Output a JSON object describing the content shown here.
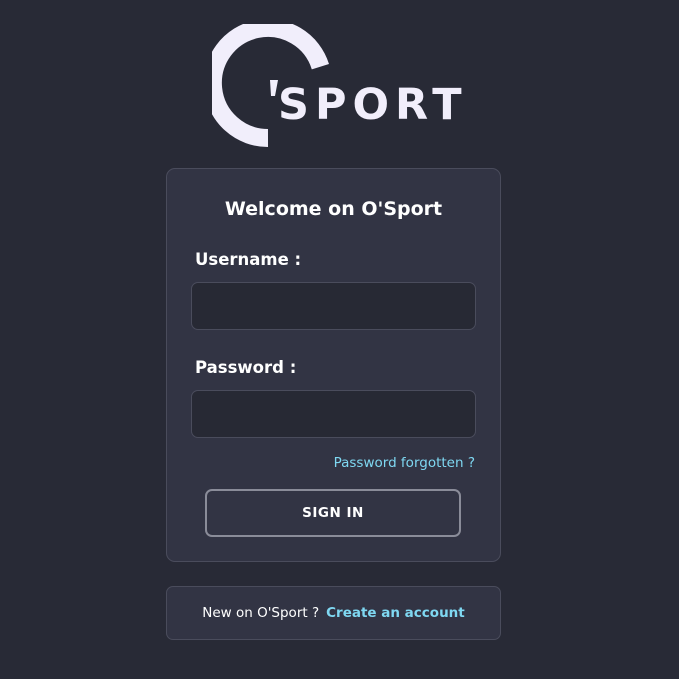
{
  "logo": {
    "wordmark": "SPORT",
    "color": "#f1eefb"
  },
  "login": {
    "title": "Welcome on O'Sport",
    "username_label": "Username :",
    "username_value": "",
    "password_label": "Password :",
    "password_value": "",
    "forgot_link": "Password forgotten ?",
    "signin_button": "SIGN IN"
  },
  "register": {
    "text": "New on O'Sport ?",
    "link": "Create an account"
  },
  "colors": {
    "background": "#282a36",
    "card": "#323444",
    "input": "#272934",
    "accent_link": "#7fd8f2"
  }
}
